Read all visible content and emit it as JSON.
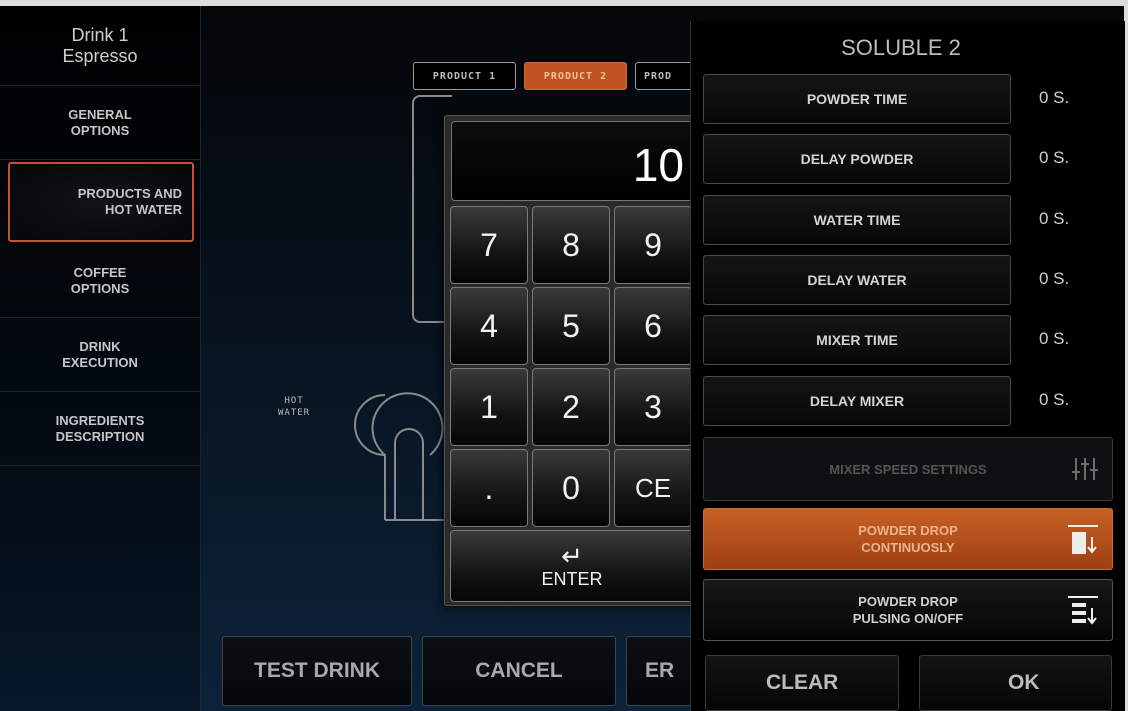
{
  "sidebar": {
    "drink_name": "Drink 1",
    "drink_type": "Espresso",
    "items": [
      {
        "label_1": "GENERAL",
        "label_2": "OPTIONS"
      },
      {
        "label_1": "PRODUCTS AND",
        "label_2": "HOT WATER"
      },
      {
        "label_1": "COFFEE",
        "label_2": "OPTIONS"
      },
      {
        "label_1": "DRINK",
        "label_2": "EXECUTION"
      },
      {
        "label_1": "INGREDIENTS",
        "label_2": "DESCRIPTION"
      }
    ],
    "active_index": 1
  },
  "products": {
    "tabs": [
      "PRODUCT 1",
      "PRODUCT 2",
      "PROD"
    ],
    "selected_tab_index": 1,
    "hot_water_label_1": "HOT",
    "hot_water_label_2": "WATER"
  },
  "bottom_buttons": {
    "test_drink": "TEST DRINK",
    "cancel": "CANCEL",
    "third": "ER"
  },
  "keypad": {
    "display_value": "10",
    "keys": [
      "7",
      "8",
      "9",
      "4",
      "5",
      "6",
      "1",
      "2",
      "3",
      ".",
      "0",
      "CE"
    ],
    "enter_icon": "↵",
    "enter_label": "ENTER"
  },
  "panel": {
    "title": "SOLUBLE 2",
    "params": [
      {
        "label": "POWDER TIME",
        "value": "0 S."
      },
      {
        "label": "DELAY POWDER",
        "value": "0 S."
      },
      {
        "label": "WATER TIME",
        "value": "0 S."
      },
      {
        "label": "DELAY WATER",
        "value": "0 S."
      },
      {
        "label": "MIXER TIME",
        "value": "0 S."
      },
      {
        "label": "DELAY MIXER",
        "value": "0 S."
      }
    ],
    "mixer_speed_label": "MIXER SPEED SETTINGS",
    "powder_drop_continuous_1": "POWDER DROP",
    "powder_drop_continuous_2": "CONTINUOSLY",
    "powder_drop_pulsing_1": "POWDER DROP",
    "powder_drop_pulsing_2": "PULSING ON/OFF",
    "clear_label": "CLEAR",
    "ok_label": "OK"
  },
  "colors": {
    "accent_orange": "#c0531f",
    "active_border": "#c8512a"
  }
}
